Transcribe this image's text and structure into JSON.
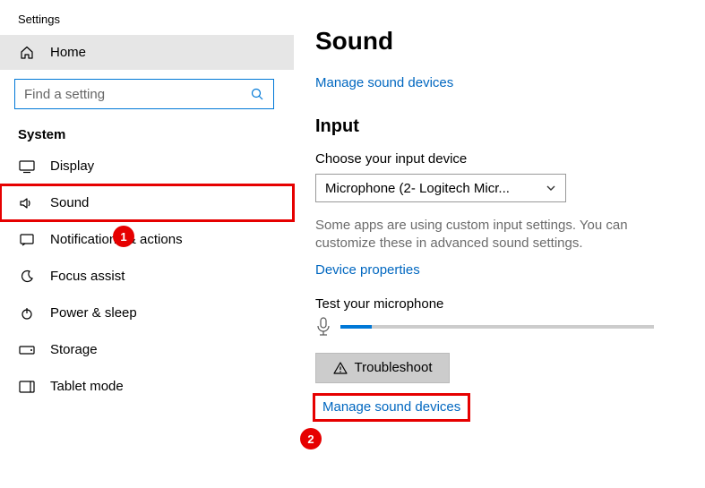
{
  "window": {
    "title": "Settings"
  },
  "home": {
    "label": "Home"
  },
  "search": {
    "placeholder": "Find a setting"
  },
  "category": {
    "label": "System"
  },
  "nav": {
    "display": "Display",
    "sound": "Sound",
    "notifications": "Notifications & actions",
    "focus": "Focus assist",
    "power": "Power & sleep",
    "storage": "Storage",
    "tablet": "Tablet mode"
  },
  "main": {
    "title": "Sound",
    "manage_link": "Manage sound devices",
    "input_title": "Input",
    "choose_label": "Choose your input device",
    "device_value": "Microphone (2- Logitech Micr...",
    "helper_text": "Some apps are using custom input settings. You can customize these in advanced sound settings.",
    "device_props_link": "Device properties",
    "test_label": "Test your microphone",
    "mic_level_percent": 10,
    "troubleshoot": "Troubleshoot",
    "manage_link2": "Manage sound devices"
  },
  "annotations": {
    "badge1": "1",
    "badge2": "2"
  }
}
